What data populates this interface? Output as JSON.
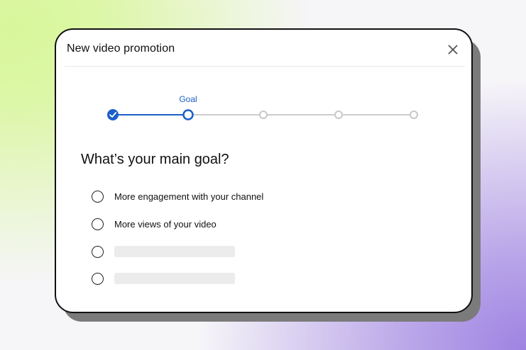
{
  "dialog": {
    "title": "New video promotion"
  },
  "stepper": {
    "current_step_label": "Goal",
    "steps": [
      {
        "status": "completed",
        "icon": "check-icon"
      },
      {
        "status": "current"
      },
      {
        "status": "upcoming"
      },
      {
        "status": "upcoming"
      },
      {
        "status": "upcoming"
      }
    ]
  },
  "question": {
    "text": "What’s your main goal?"
  },
  "options": [
    {
      "label": "More engagement with your channel",
      "selected": false
    },
    {
      "label": "More views of your video",
      "selected": false
    },
    {
      "label": "",
      "selected": false,
      "placeholder": true
    },
    {
      "label": "",
      "selected": false,
      "placeholder": true
    }
  ],
  "colors": {
    "accent": "#1a5fc9",
    "inactive_step": "#cccccc"
  }
}
